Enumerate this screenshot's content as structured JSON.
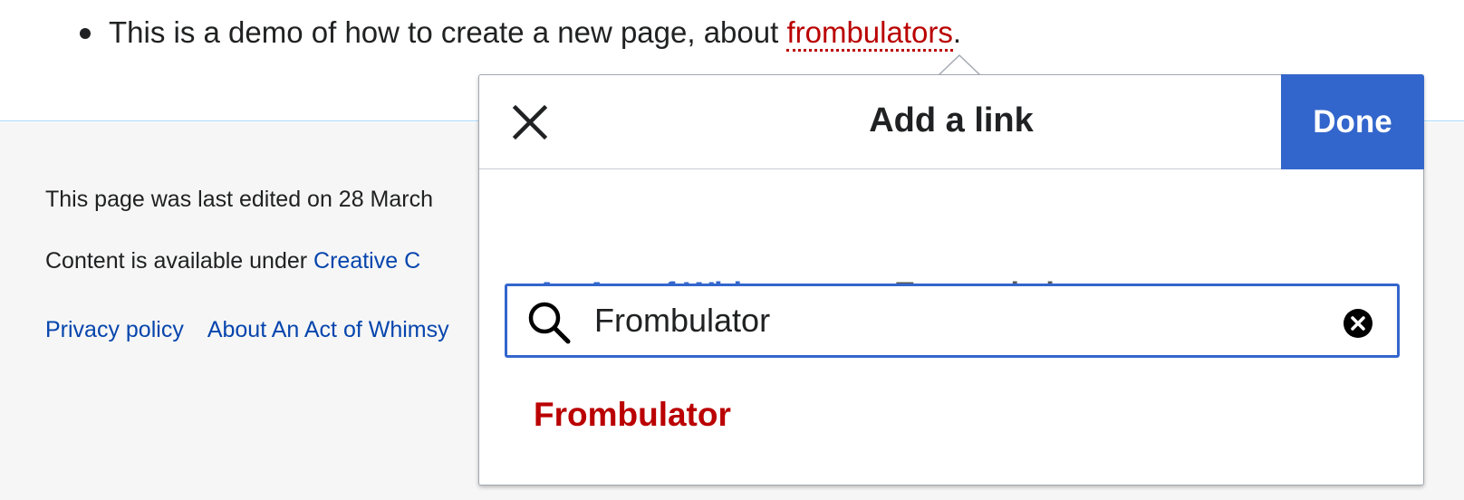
{
  "article": {
    "text": "This is a demo of how to create a new page, about ",
    "link_text": "frombulators",
    "suffix": "."
  },
  "footer": {
    "last_edited": "This page was last edited on 28 March",
    "content_prefix": "Content is available under ",
    "content_link": "Creative C",
    "nav": [
      "Privacy policy",
      "About An Act of Whimsy"
    ]
  },
  "dialog": {
    "title": "Add a link",
    "done_label": "Done",
    "tabs": [
      {
        "label": "An Act of Whimsy",
        "active": true
      },
      {
        "label": "External site",
        "active": false
      }
    ],
    "search": {
      "value": "Frombulator"
    },
    "results": [
      "Frombulator"
    ]
  },
  "colors": {
    "accent": "#3366cc",
    "redlink": "#ba0000",
    "footer_link": "#0645ad"
  }
}
